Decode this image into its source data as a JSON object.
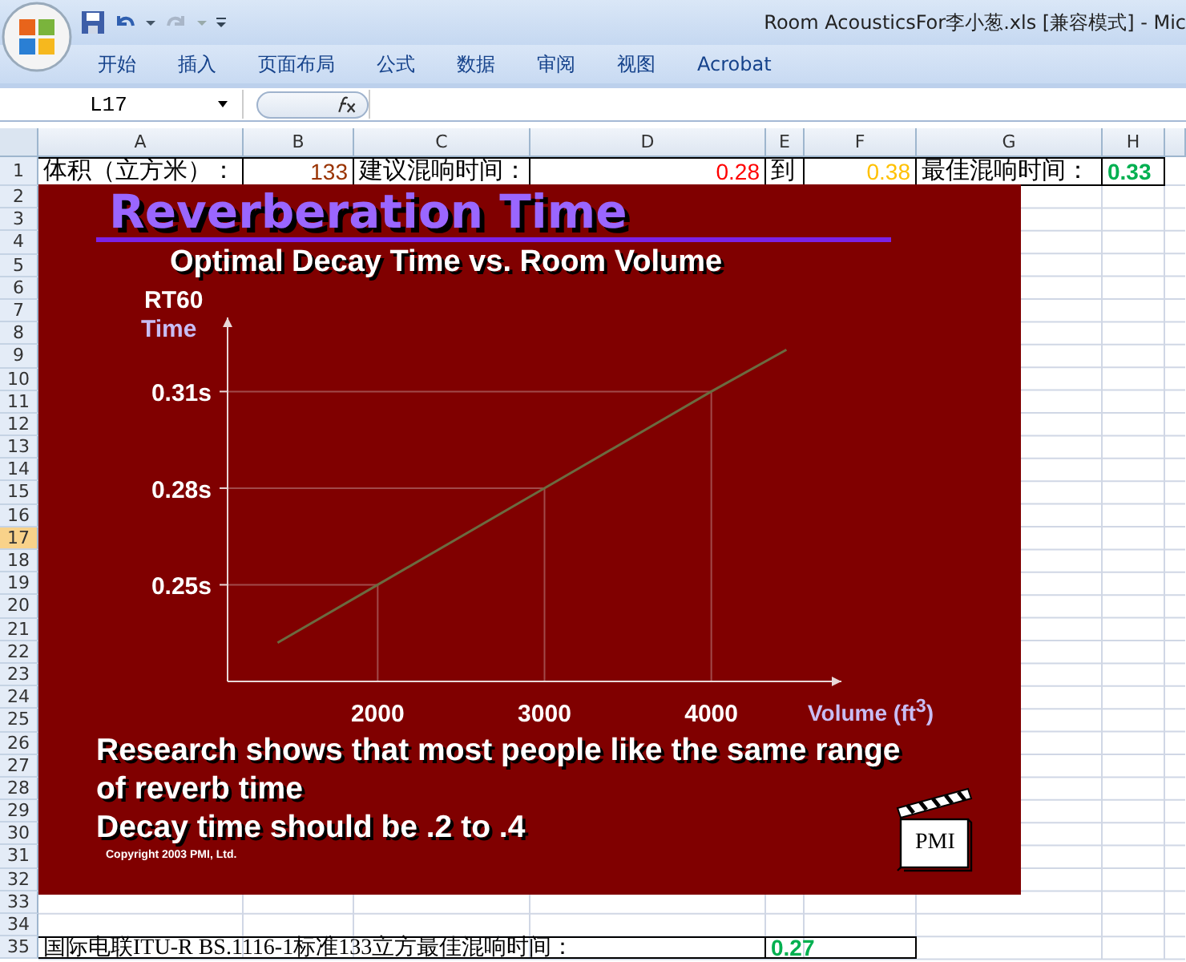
{
  "window": {
    "title": "Room AcousticsFor李小葱.xls  [兼容模式] - Mic"
  },
  "ribbon_tabs": [
    "开始",
    "插入",
    "页面布局",
    "公式",
    "数据",
    "审阅",
    "视图",
    "Acrobat"
  ],
  "formula_bar": {
    "name_box": "L17"
  },
  "sheet": {
    "columns": [
      "A",
      "B",
      "C",
      "D",
      "E",
      "F",
      "G",
      "H"
    ],
    "rows": [
      {
        "number": "1",
        "selected": false,
        "cells": [
          {
            "kind": "label",
            "text": "体积（立方米）："
          },
          {
            "kind": "number",
            "text": "133",
            "color": "#993300"
          },
          {
            "kind": "label",
            "text": "建议混响时间："
          },
          {
            "kind": "number",
            "text": "0.28",
            "color": "#ff0000"
          },
          {
            "kind": "label",
            "text": "到"
          },
          {
            "kind": "number",
            "text": "0.38",
            "color": "#ffc000"
          },
          {
            "kind": "label",
            "text": "最佳混响时间："
          },
          {
            "kind": "result",
            "text": "0.33",
            "color": "#00b050"
          }
        ]
      },
      {
        "number": "2",
        "selected": false
      },
      {
        "number": "3",
        "selected": false
      },
      {
        "number": "4",
        "selected": false
      },
      {
        "number": "5",
        "selected": false
      },
      {
        "number": "6",
        "selected": false
      },
      {
        "number": "7",
        "selected": false
      },
      {
        "number": "8",
        "selected": false
      },
      {
        "number": "9",
        "selected": false
      },
      {
        "number": "10",
        "selected": false
      },
      {
        "number": "11",
        "selected": false
      },
      {
        "number": "12",
        "selected": false
      },
      {
        "number": "13",
        "selected": false
      },
      {
        "number": "14",
        "selected": false
      },
      {
        "number": "15",
        "selected": false
      },
      {
        "number": "16",
        "selected": false
      },
      {
        "number": "17",
        "selected": true
      },
      {
        "number": "18",
        "selected": false
      },
      {
        "number": "19",
        "selected": false
      },
      {
        "number": "20",
        "selected": false
      },
      {
        "number": "21",
        "selected": false
      },
      {
        "number": "22",
        "selected": false
      },
      {
        "number": "23",
        "selected": false
      },
      {
        "number": "24",
        "selected": false
      },
      {
        "number": "25",
        "selected": false
      },
      {
        "number": "26",
        "selected": false
      },
      {
        "number": "27",
        "selected": false
      },
      {
        "number": "28",
        "selected": false
      },
      {
        "number": "29",
        "selected": false
      },
      {
        "number": "30",
        "selected": false
      },
      {
        "number": "31",
        "selected": false
      },
      {
        "number": "32",
        "selected": false
      },
      {
        "number": "33",
        "selected": false
      },
      {
        "number": "34",
        "selected": false
      },
      {
        "number": "35",
        "selected": false,
        "summary": {
          "label": "国际电联ITU-R BS.1116-1标准133立方最佳混响时间：",
          "value": "0.27",
          "color": "#00b050"
        }
      }
    ]
  },
  "slide": {
    "title": "Reverberation Time",
    "subtitle": "Optimal Decay Time vs. Room Volume",
    "chart_data": {
      "type": "line",
      "ylabel": "Time",
      "xlabel": "Volume (ft$^{3}$)",
      "x": [
        1400,
        2000,
        3000,
        4000,
        4450
      ],
      "series": [
        {
          "name": "RT60",
          "color": "#6b6b40",
          "values": [
            0.232,
            0.25,
            0.28,
            0.31,
            0.323
          ]
        }
      ],
      "xlim": [
        1100,
        4780
      ],
      "ylim": [
        0.22,
        0.333
      ],
      "xticks": [
        2000,
        3000,
        4000
      ],
      "yticks": [
        {
          "value": 0.25,
          "label": "0.25s"
        },
        {
          "value": 0.28,
          "label": "0.28s"
        },
        {
          "value": 0.31,
          "label": "0.31s"
        }
      ],
      "ref_lines": [
        {
          "axis": "y",
          "value": 0.25
        },
        {
          "axis": "y",
          "value": 0.28
        },
        {
          "axis": "y",
          "value": 0.31
        },
        {
          "axis": "x",
          "value": 2000
        },
        {
          "axis": "x",
          "value": 3000
        },
        {
          "axis": "x",
          "value": 4000
        }
      ]
    },
    "paragraphs": [
      "Research shows that most people like the same range of reverb time",
      "Decay time should be .2 to .4"
    ],
    "copyright": "Copyright 2003 PMI, Ltd.",
    "logo_text": "PMI"
  }
}
